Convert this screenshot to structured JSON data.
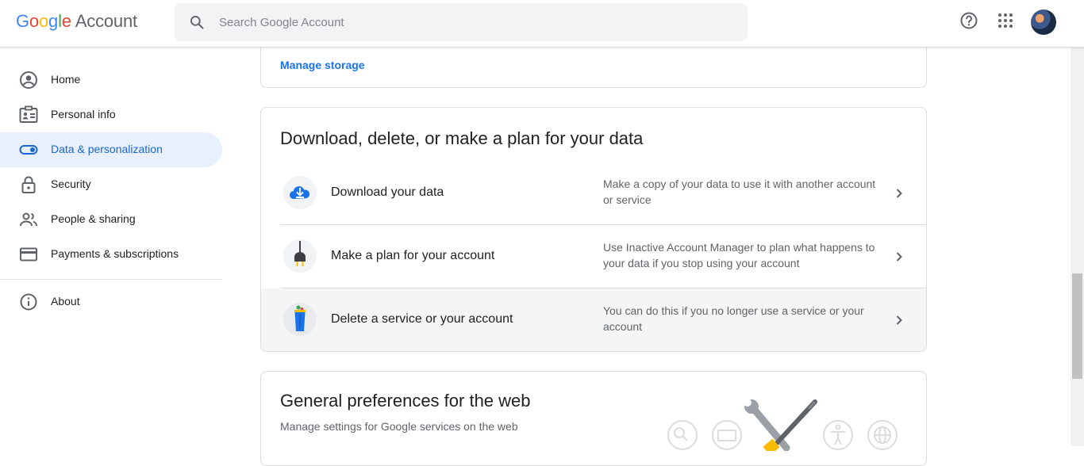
{
  "header": {
    "logo_letters": [
      "G",
      "o",
      "o",
      "g",
      "l",
      "e"
    ],
    "logo_product": "Account",
    "search_placeholder": "Search Google Account",
    "icons": [
      "search-icon",
      "help-icon",
      "apps-grid-icon",
      "avatar"
    ]
  },
  "sidebar": {
    "items": [
      {
        "label": "Home",
        "icon": "account-circle-icon",
        "active": false
      },
      {
        "label": "Personal info",
        "icon": "id-card-icon",
        "active": false
      },
      {
        "label": "Data & personalization",
        "icon": "toggle-icon",
        "active": true
      },
      {
        "label": "Security",
        "icon": "lock-icon",
        "active": false
      },
      {
        "label": "People & sharing",
        "icon": "people-icon",
        "active": false
      },
      {
        "label": "Payments & subscriptions",
        "icon": "credit-card-icon",
        "active": false
      }
    ],
    "footer_items": [
      {
        "label": "About",
        "icon": "info-icon"
      }
    ]
  },
  "storage_card": {
    "link": "Manage storage"
  },
  "data_card": {
    "title": "Download, delete, or make a plan for your data",
    "rows": [
      {
        "title": "Download your data",
        "description": "Make a copy of your data to use it with another account or service",
        "icon": "cloud-download-icon"
      },
      {
        "title": "Make a plan for your account",
        "description": "Use Inactive Account Manager to plan what happens to your data if you stop using your account",
        "icon": "plug-icon"
      },
      {
        "title": "Delete a service or your account",
        "description": "You can do this if you no longer use a service or your account",
        "icon": "trash-bin-icon"
      }
    ]
  },
  "prefs_card": {
    "title": "General preferences for the web",
    "subtitle": "Manage settings for Google services on the web"
  },
  "colors": {
    "accent": "#1a73e8",
    "active_bg": "#e8f0fe",
    "border": "#dadce0",
    "text_secondary": "#5f6368"
  }
}
